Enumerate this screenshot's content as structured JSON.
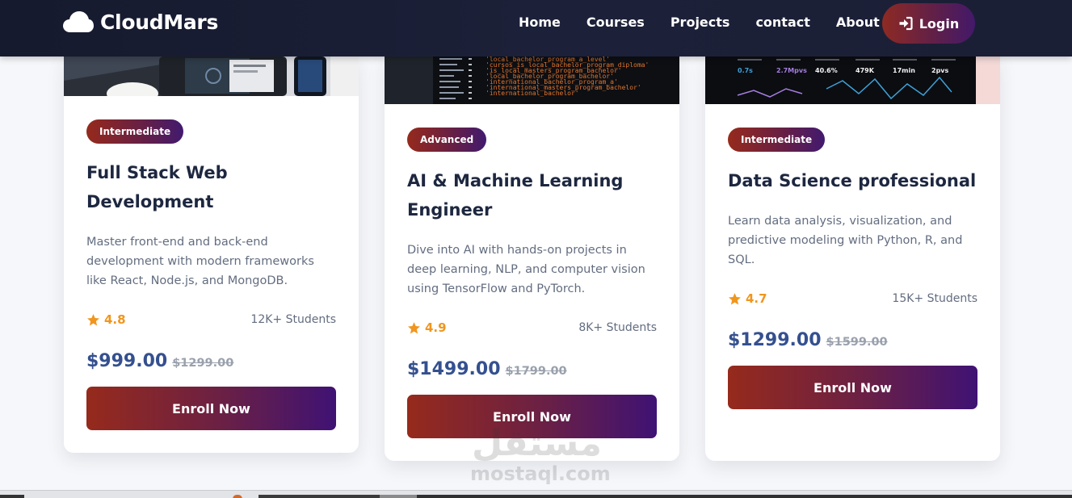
{
  "brand": {
    "name": "CloudMars",
    "logo_icon": "cloud-icon"
  },
  "nav": {
    "links": [
      "Home",
      "Courses",
      "Projects",
      "contact",
      "About"
    ],
    "login_label": "Login",
    "login_icon": "login-icon"
  },
  "colors": {
    "nav_bg": "#1b1f36",
    "accent_start": "#962a1c",
    "accent_end": "#421a6f",
    "price": "#34508f",
    "rating": "#f0961e"
  },
  "courses": [
    {
      "level": "Intermediate",
      "title_line1": "Full Stack Web",
      "title_line2": "Development",
      "description": "Master front-end and back-end development with modern frameworks like React, Node.js, and MongoDB.",
      "rating": "4.8",
      "students": "12K+ Students",
      "price": "$999.00",
      "old_price": "$1299.00",
      "cta": "Enroll Now"
    },
    {
      "level": "Advanced",
      "title_line1": "AI & Machine Learning",
      "title_line2": "Engineer",
      "description": "Dive into AI with hands-on projects in deep learning, NLP, and computer vision using TensorFlow and PyTorch.",
      "rating": "4.9",
      "students": "8K+ Students",
      "price": "$1499.00",
      "old_price": "$1799.00",
      "cta": "Enroll Now"
    },
    {
      "level": "Intermediate",
      "title_line1": "Data Science professional",
      "title_line2": "",
      "description": "Learn data analysis, visualization, and predictive modeling with Python, R, and SQL.",
      "rating": "4.7",
      "students": "15K+ Students",
      "price": "$1299.00",
      "old_price": "$1599.00",
      "cta": "Enroll Now"
    }
  ],
  "code_snippet": [
    "'local_bachelor_program_a_level'",
    "'cursos_is_local_bachelor_program_diploma'",
    "'is_local_masters_program_bachelor'",
    "'local_bachelor_program_bachelor'",
    "'international_bachelor_program_a'",
    "'international_masters_program_bachelor'",
    "'international_bachelor'"
  ],
  "dashboard_stats": [
    "0.7s",
    "2.7Mpvs",
    "40.6%",
    "479K",
    "17min",
    "2pvs"
  ],
  "watermark": {
    "arabic": "مستقل",
    "latin": "mostaql.com"
  }
}
